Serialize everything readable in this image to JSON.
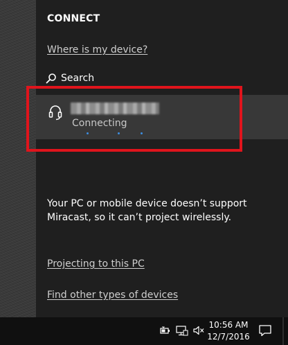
{
  "connect_panel": {
    "title": "CONNECT",
    "where_link": "Where is my device?",
    "search_label": "Search",
    "search_icon": "search-icon",
    "device": {
      "icon": "headset-icon",
      "name": "",
      "status": "Connecting"
    },
    "message": "Your PC or mobile device doesn’t support Miracast, so it can’t project wirelessly.",
    "projecting_link": "Projecting to this PC",
    "find_link": "Find other types of devices"
  },
  "annotation": {
    "highlight_color": "#e0141c"
  },
  "taskbar": {
    "tray_icons": [
      "battery-icon",
      "network-icon",
      "volume-muted-icon"
    ],
    "time": "10:56 AM",
    "date": "12/7/2016",
    "notification_icon": "action-center-icon"
  },
  "colors": {
    "panel_bg": "#1f1f1f",
    "device_row_bg": "#383838",
    "progress_dot": "#3d8ee0"
  }
}
